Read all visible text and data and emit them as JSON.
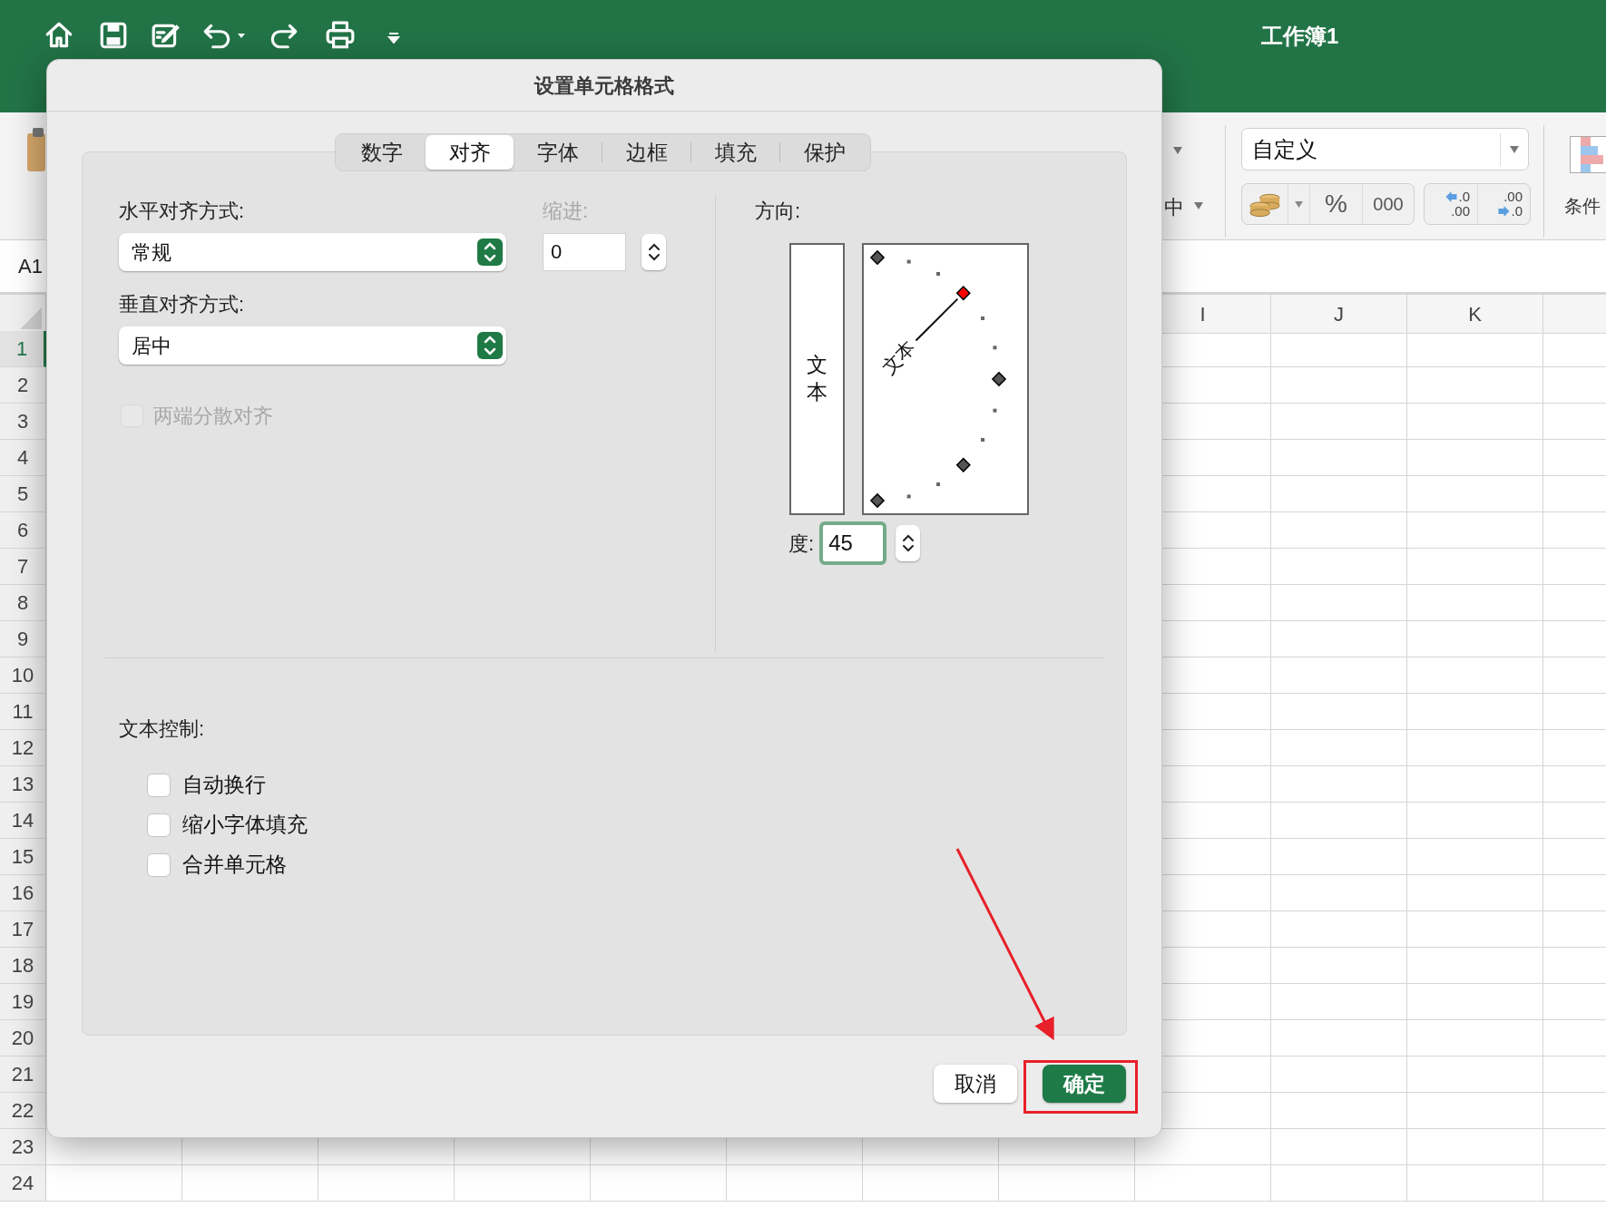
{
  "window": {
    "title": "工作簿1"
  },
  "ribbon": {
    "merge_label": "中",
    "number_format": {
      "value": "自定义"
    },
    "percent_button": "%",
    "thousands_button": "000",
    "increase_decimal": {
      "top": ".0",
      "bottom": ".00"
    },
    "decrease_decimal": {
      "top": ".00",
      "bottom": ".0"
    },
    "conditional_format_label": "条件"
  },
  "name_box": "A1",
  "columns": [
    "I",
    "J",
    "K"
  ],
  "rows": [
    {
      "label": "1",
      "selected": true
    },
    {
      "label": "2",
      "selected": false
    },
    {
      "label": "3",
      "selected": false
    },
    {
      "label": "4",
      "selected": false
    },
    {
      "label": "5",
      "selected": false
    },
    {
      "label": "6",
      "selected": false
    },
    {
      "label": "7",
      "selected": false
    },
    {
      "label": "8",
      "selected": false
    },
    {
      "label": "9",
      "selected": false
    },
    {
      "label": "10",
      "selected": false
    },
    {
      "label": "11",
      "selected": false
    },
    {
      "label": "12",
      "selected": false
    },
    {
      "label": "13",
      "selected": false
    },
    {
      "label": "14",
      "selected": false
    },
    {
      "label": "15",
      "selected": false
    },
    {
      "label": "16",
      "selected": false
    },
    {
      "label": "17",
      "selected": false
    },
    {
      "label": "18",
      "selected": false
    },
    {
      "label": "19",
      "selected": false
    },
    {
      "label": "20",
      "selected": false
    },
    {
      "label": "21",
      "selected": false
    },
    {
      "label": "22",
      "selected": false
    },
    {
      "label": "23",
      "selected": false
    },
    {
      "label": "24",
      "selected": false
    }
  ],
  "dialog": {
    "title": "设置单元格格式",
    "tabs": [
      {
        "label": "数字",
        "selected": false
      },
      {
        "label": "对齐",
        "selected": true
      },
      {
        "label": "字体",
        "selected": false
      },
      {
        "label": "边框",
        "selected": false
      },
      {
        "label": "填充",
        "selected": false
      },
      {
        "label": "保护",
        "selected": false
      }
    ],
    "horizontal": {
      "label": "水平对齐方式:",
      "value": "常规"
    },
    "indent": {
      "label": "缩进:",
      "value": "0",
      "disabled": true
    },
    "vertical": {
      "label": "垂直对齐方式:",
      "value": "居中"
    },
    "justify_distributed": {
      "label": "两端分散对齐",
      "checked": false,
      "disabled": true
    },
    "orientation": {
      "label": "方向:",
      "vertical_text": "文本",
      "rotated_text": "文本",
      "degrees_label": "度:",
      "degrees": "45"
    },
    "text_control": {
      "label": "文本控制:",
      "options": [
        {
          "label": "自动换行",
          "checked": false
        },
        {
          "label": "缩小字体填充",
          "checked": false
        },
        {
          "label": "合并单元格",
          "checked": false
        }
      ]
    },
    "buttons": [
      {
        "label": "取消",
        "kind": "cancel"
      },
      {
        "label": "确定",
        "kind": "default"
      }
    ]
  }
}
